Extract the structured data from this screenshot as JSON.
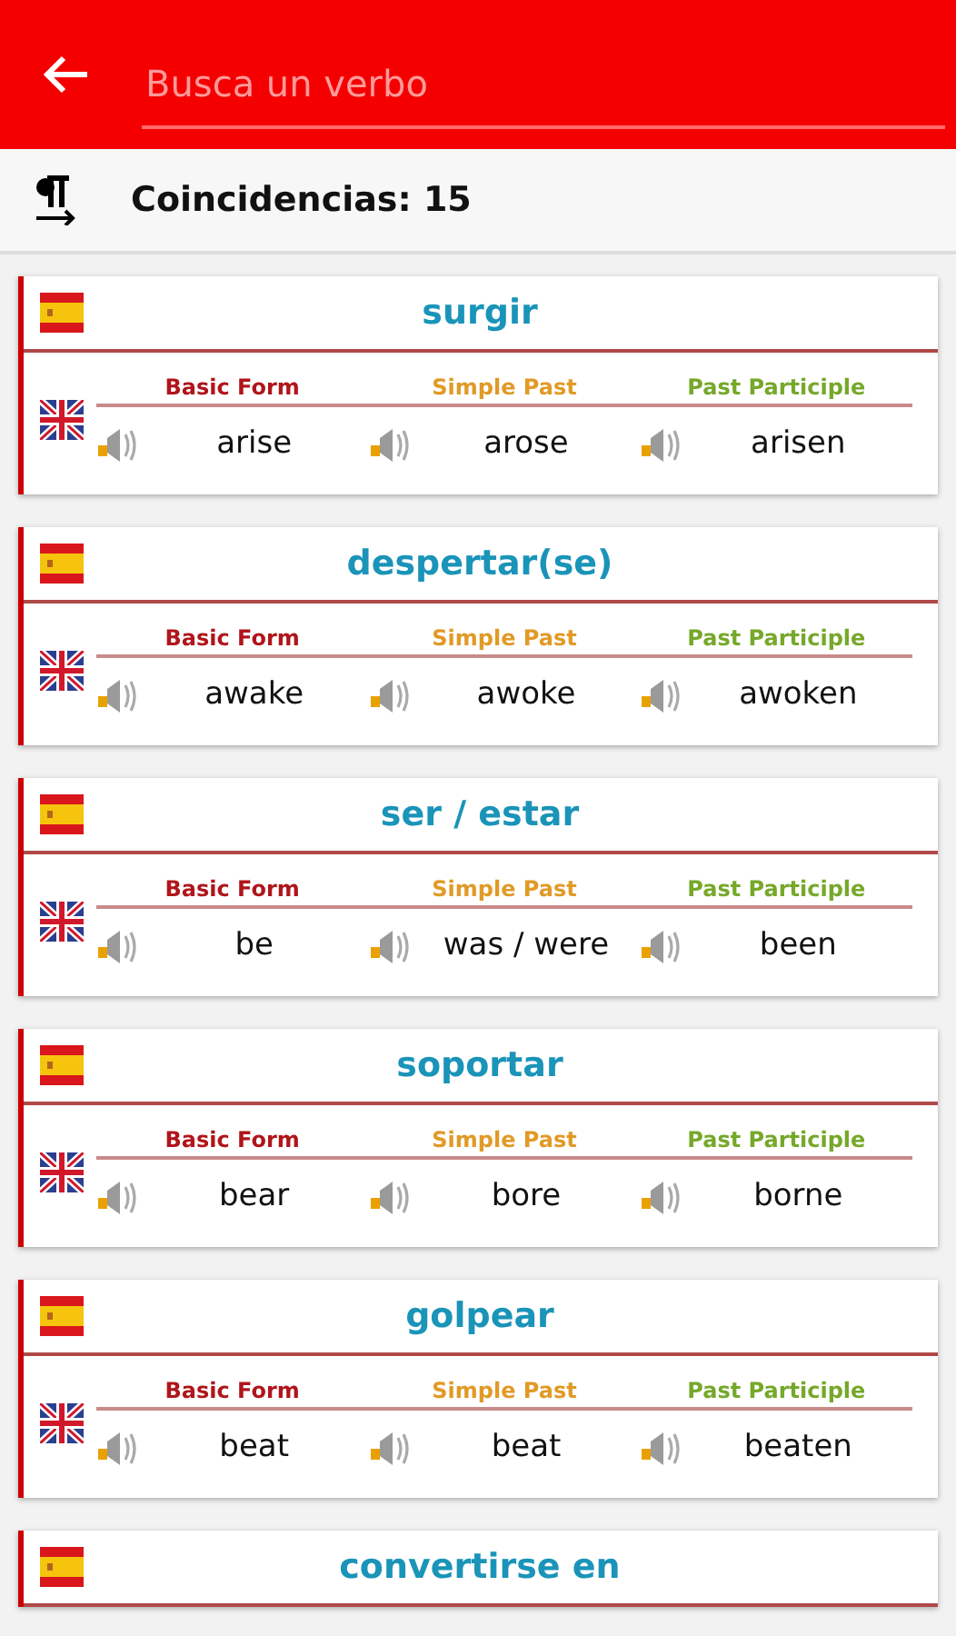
{
  "search": {
    "placeholder": "Busca un verbo"
  },
  "matches": "Coincidencias: 15",
  "verbs": [
    {
      "spanish": "surgir",
      "headers": [
        "Basic Form",
        "Simple Past",
        "Past Participle"
      ],
      "forms": [
        "arise",
        "arose",
        "arisen"
      ]
    },
    {
      "spanish": "despertar(se)",
      "headers": [
        "Basic Form",
        "Simple Past",
        "Past Participle"
      ],
      "forms": [
        "awake",
        "awoke",
        "awoken"
      ]
    },
    {
      "spanish": "ser / estar",
      "headers": [
        "Basic Form",
        "Simple Past",
        "Past Participle"
      ],
      "forms": [
        "be",
        "was / were",
        "been"
      ]
    },
    {
      "spanish": "soportar",
      "headers": [
        "Basic Form",
        "Simple Past",
        "Past Participle"
      ],
      "forms": [
        "bear",
        "bore",
        "borne"
      ]
    },
    {
      "spanish": "golpear",
      "headers": [
        "Basic Form",
        "Simple Past",
        "Past Participle"
      ],
      "forms": [
        "beat",
        "beat",
        "beaten"
      ]
    },
    {
      "spanish": "convertirse en"
    }
  ]
}
